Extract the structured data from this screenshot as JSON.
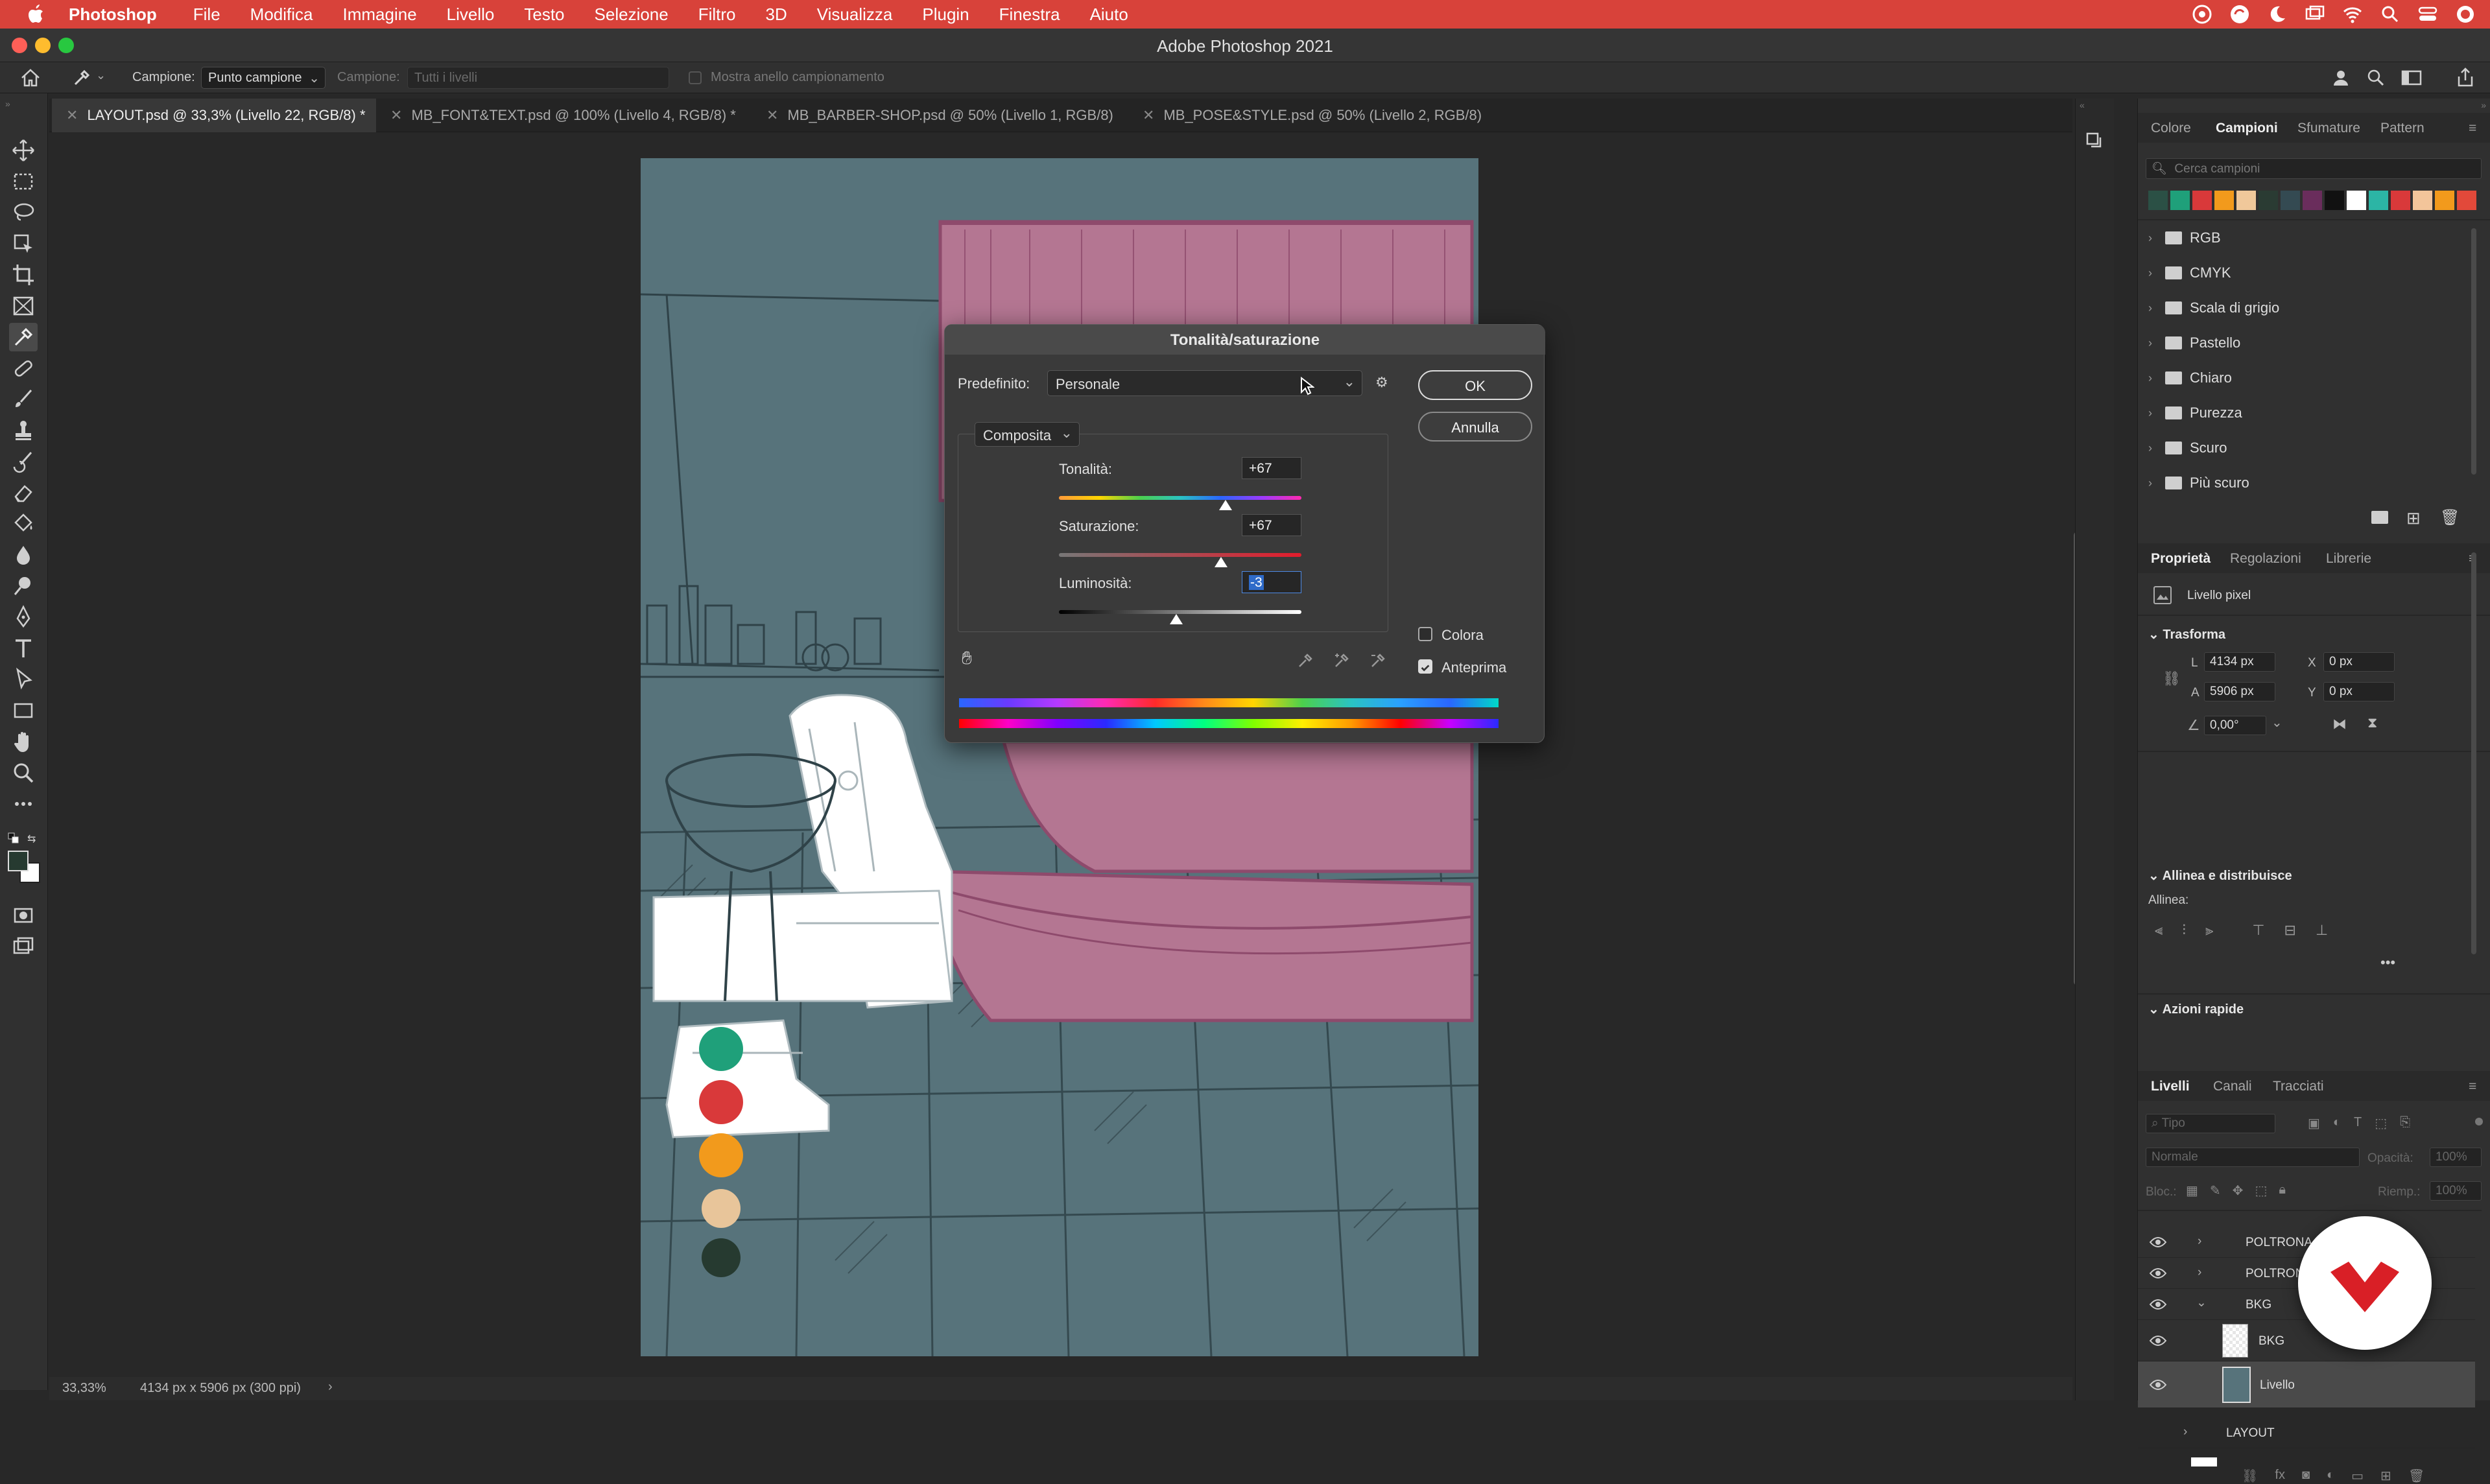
{
  "menubar": {
    "app_name": "Photoshop",
    "items": [
      "File",
      "Modifica",
      "Immagine",
      "Livello",
      "Testo",
      "Selezione",
      "Filtro",
      "3D",
      "Visualizza",
      "Plugin",
      "Finestra",
      "Aiuto"
    ]
  },
  "window": {
    "title": "Adobe Photoshop 2021"
  },
  "options_bar": {
    "sample_label": "Campione:",
    "sample_value": "Punto campione",
    "sample2_label": "Campione:",
    "sample2_value": "Tutti i livelli",
    "show_ring_label": "Mostra anello campionamento"
  },
  "tabs": [
    {
      "label": "LAYOUT.psd @ 33,3% (Livello 22, RGB/8) *"
    },
    {
      "label": "MB_FONT&TEXT.psd @ 100% (Livello 4, RGB/8) *"
    },
    {
      "label": "MB_BARBER-SHOP.psd @ 50% (Livello 1, RGB/8)"
    },
    {
      "label": "MB_POSE&STYLE.psd @ 50% (Livello 2, RGB/8)"
    }
  ],
  "status_bar": {
    "zoom": "33,33%",
    "doc_info": "4134 px x 5906 px (300 ppi)"
  },
  "swatches_panel": {
    "tabs": [
      "Colore",
      "Campioni",
      "Sfumature",
      "Pattern"
    ],
    "active_tab": "Campioni",
    "search_placeholder": "Cerca campioni",
    "recent_colors": [
      "#2b5045",
      "#1fa07a",
      "#d9393a",
      "#f29a1c",
      "#f0c89a",
      "#2a3b33",
      "#344a52",
      "#6a2d5c",
      "#111111",
      "#ffffff",
      "#2cb5a5",
      "#d9393a",
      "#f3c59a",
      "#f29a1c",
      "#e2493a"
    ],
    "groups": [
      "RGB",
      "CMYK",
      "Scala di grigio",
      "Pastello",
      "Chiaro",
      "Purezza",
      "Scuro",
      "Più scuro"
    ]
  },
  "properties_panel": {
    "tabs": [
      "Proprietà",
      "Regolazioni",
      "Librerie"
    ],
    "layer_type": "Livello pixel",
    "transform_title": "Trasforma",
    "w_label": "L",
    "w_value": "4134 px",
    "h_label": "A",
    "h_value": "5906 px",
    "x_label": "X",
    "x_value": "0 px",
    "y_label": "Y",
    "y_value": "0 px",
    "angle_value": "0,00°",
    "align_title": "Allinea e distribuisce",
    "align_label": "Allinea:",
    "quick_actions_title": "Azioni rapide"
  },
  "layers_panel": {
    "tabs": [
      "Livelli",
      "Canali",
      "Tracciati"
    ],
    "filter_placeholder": "Tipo",
    "blend_mode": "Normale",
    "opacity_label": "Opacità:",
    "opacity_value": "100%",
    "lock_label": "Bloc.:",
    "fill_label": "Riemp.:",
    "fill_value": "100%",
    "layers": [
      {
        "name": "POLTRONA 2"
      },
      {
        "name": "POLTRONA 1"
      },
      {
        "name": "BKG"
      },
      {
        "name": "BKG"
      },
      {
        "name": "Livello"
      },
      {
        "name": "LAYOUT"
      }
    ]
  },
  "dialog": {
    "title": "Tonalità/saturazione",
    "preset_label": "Predefinito:",
    "preset_value": "Personale",
    "channel_value": "Composita",
    "ok_label": "OK",
    "cancel_label": "Annulla",
    "hue_label": "Tonalità:",
    "hue_value": "+67",
    "saturation_label": "Saturazione:",
    "saturation_value": "+67",
    "lightness_label": "Luminosità:",
    "lightness_value": "-3",
    "colorize_label": "Colora",
    "colorize_checked": false,
    "preview_label": "Anteprima",
    "preview_checked": true,
    "hue_level": 0.686,
    "saturation_level": 0.668,
    "lightness_level": 0.485
  },
  "canvas_palette": [
    "#1fa07a",
    "#d9393a",
    "#f29a1c",
    "#e8c59a",
    "#263a30"
  ]
}
